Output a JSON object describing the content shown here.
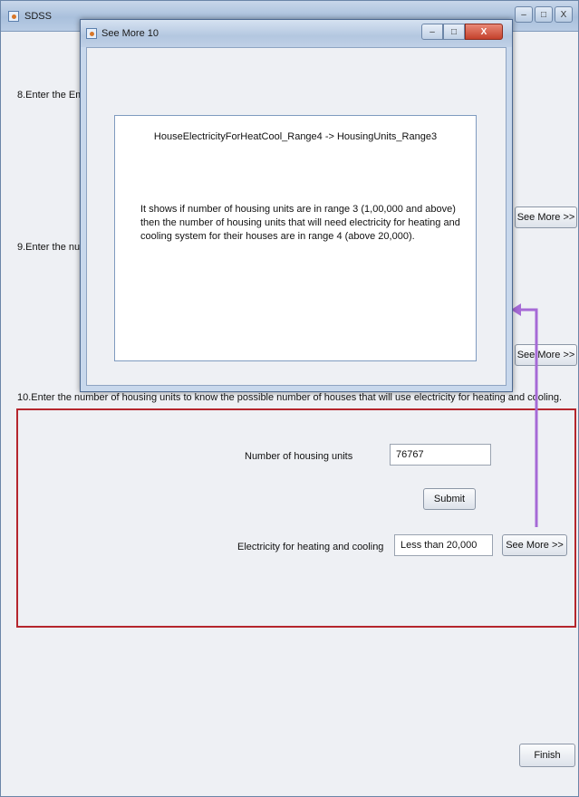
{
  "main_window": {
    "title": "SDSS",
    "minimize": "–",
    "maximize": "□",
    "close": "X"
  },
  "questions": {
    "q8_label": "8.Enter the Emp",
    "q9_label": "9.Enter the num",
    "q10_label": "10.Enter the number of housing units to know the possible number of houses that will use electricity for heating and cooling."
  },
  "see_more_q8": "See More >>",
  "see_more_q9": "See More >>",
  "section10": {
    "housing_units_label": "Number of housing units",
    "housing_units_value": "76767",
    "submit_label": "Submit",
    "electricity_label": "Electricity for heating and cooling",
    "electricity_value": "Less than 20,000",
    "see_more_label": "See More >>"
  },
  "finish_label": "Finish",
  "popup": {
    "title": "See More 10",
    "minimize": "–",
    "maximize": "□",
    "close": "X",
    "rule_heading": "HouseElectricityForHeatCool_Range4 -> HousingUnits_Range3",
    "rule_text": "It shows if number of housing units are in range 3 (1,00,000 and above) then the number of housing units that will need electricity for heating and cooling system for their houses are in range 4 (above 20,000)."
  },
  "colors": {
    "highlight_border": "#b5262d",
    "arrow": "#a66ad6"
  }
}
